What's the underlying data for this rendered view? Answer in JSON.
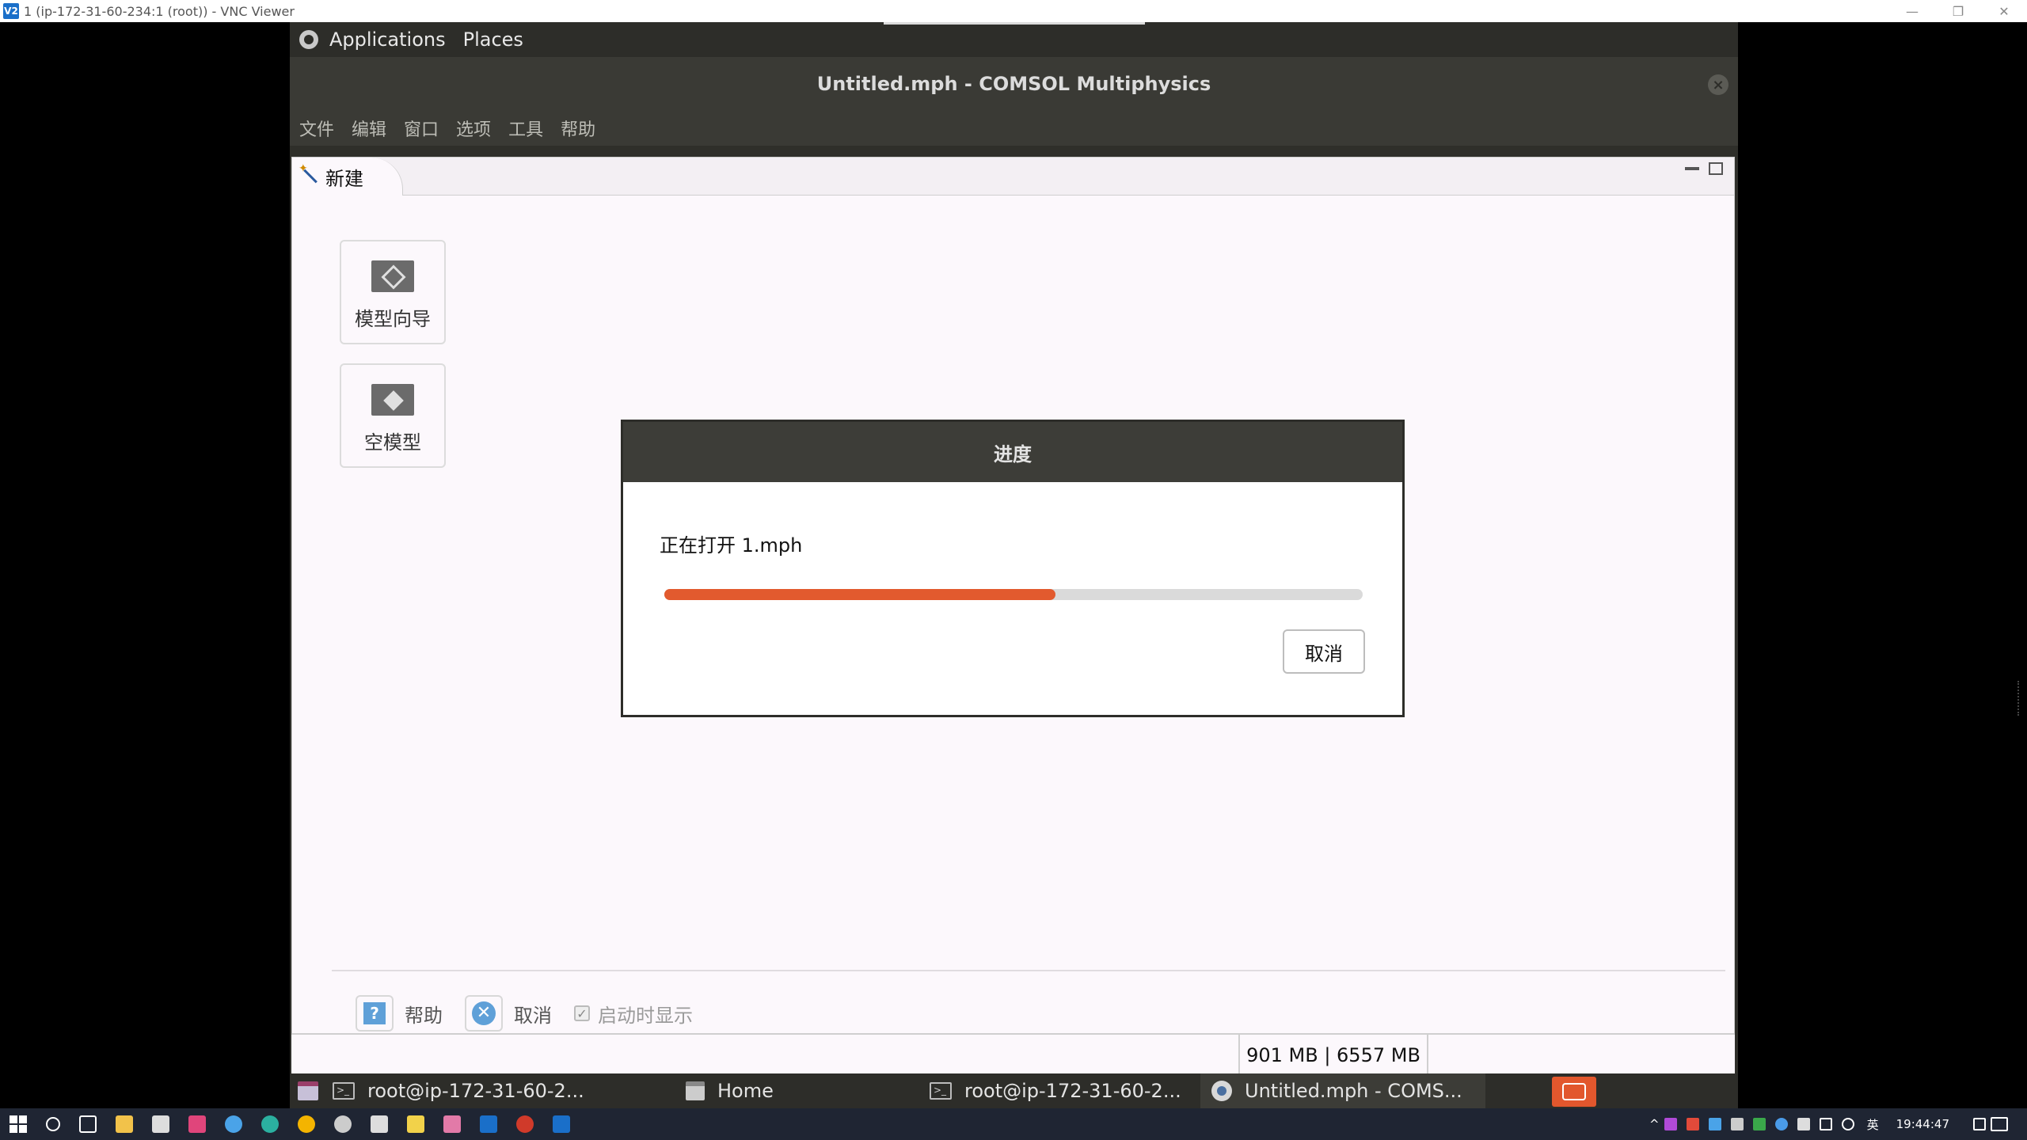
{
  "vnc": {
    "logo": "V2",
    "title": "1 (ip-172-31-60-234:1 (root)) - VNC Viewer",
    "minimize": "—",
    "restore": "❐",
    "close": "✕"
  },
  "gnome_panel": {
    "applications": "Applications",
    "places": "Places"
  },
  "window": {
    "title": "Untitled.mph - COMSOL Multiphysics",
    "close": "×"
  },
  "menubar": {
    "items": [
      "文件",
      "编辑",
      "窗口",
      "选项",
      "工具",
      "帮助"
    ]
  },
  "tab": {
    "label": "新建"
  },
  "sidebar": {
    "model_wizard": "模型向导",
    "blank_model": "空模型"
  },
  "bottom_bar": {
    "help_icon": "?",
    "help_label": "帮助",
    "cancel_icon": "✕",
    "cancel_label": "取消",
    "check_mark": "✓",
    "show_on_startup": "启动时显示",
    "show_on_startup_checked": true
  },
  "statusbar": {
    "memory": "901 MB | 6557 MB"
  },
  "dialog": {
    "title": "进度",
    "message": "正在打开 1.mph",
    "progress": 0.56,
    "cancel": "取消"
  },
  "gnome_taskbar": {
    "items": [
      {
        "label": "root@ip-172-31-60-2...",
        "icon": "terminal-icon"
      },
      {
        "label": "Home",
        "icon": "folder-icon"
      },
      {
        "label": "root@ip-172-31-60-2...",
        "icon": "terminal-icon"
      },
      {
        "label": "Untitled.mph - COMS...",
        "icon": "comsol-icon"
      }
    ]
  },
  "windows_taskbar": {
    "language": "英",
    "time": "19:44:47"
  },
  "colors": {
    "progress_fill": "#e25a2e",
    "dialog_header": "#3d3d38",
    "panel_bg": "#2d2d29"
  }
}
